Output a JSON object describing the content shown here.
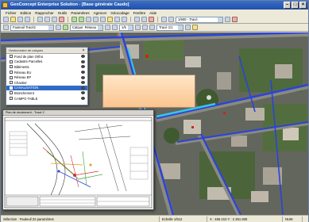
{
  "window": {
    "title": "GeoConcept Enterprise Solution - [Base générale Caudo]"
  },
  "menu": [
    "Fichier",
    "Edition",
    "Rapprocher",
    "Outils",
    "Paramètres",
    "Agencer",
    "Géocodage",
    "Fenêtre",
    "Aide"
  ],
  "toolbar": {
    "layer_combo": "Fauteuil Tracé2",
    "style_combo": "Calque: Réseau",
    "zoom_combo": "1/5",
    "right_combo": "Tracé 1/1",
    "scale_combo": "1/600 - Tracé"
  },
  "layers_panel": {
    "title": "Gestionnaire de calques",
    "items": [
      {
        "label": "Fond de plan Ortho",
        "selected": false
      },
      {
        "label": "Cadastre Parcelles",
        "selected": false
      },
      {
        "label": "Bâtiments",
        "selected": false
      },
      {
        "label": "Réseau EU",
        "selected": false
      },
      {
        "label": "Réseau EP",
        "selected": false
      },
      {
        "label": "Chantier",
        "selected": false
      },
      {
        "label": "CANALISATION",
        "selected": true
      },
      {
        "label": "Branchement",
        "selected": false
      },
      {
        "label": "CAMPO TABLE",
        "selected": false
      }
    ]
  },
  "plan_window": {
    "title": "Plan de récolement - Tracé 2"
  },
  "statusbar": {
    "left": "Sélection : Fauteuil 22 paramètres",
    "scale": "Echelle 1/512",
    "coords": "X : 456 210  Y : 2 251 830",
    "mode": "NUM"
  },
  "colors": {
    "title_bar": "#1f4fa8",
    "network_line": "#2a44d8",
    "selection": "#316ac5",
    "callout": "#fbc48e"
  }
}
